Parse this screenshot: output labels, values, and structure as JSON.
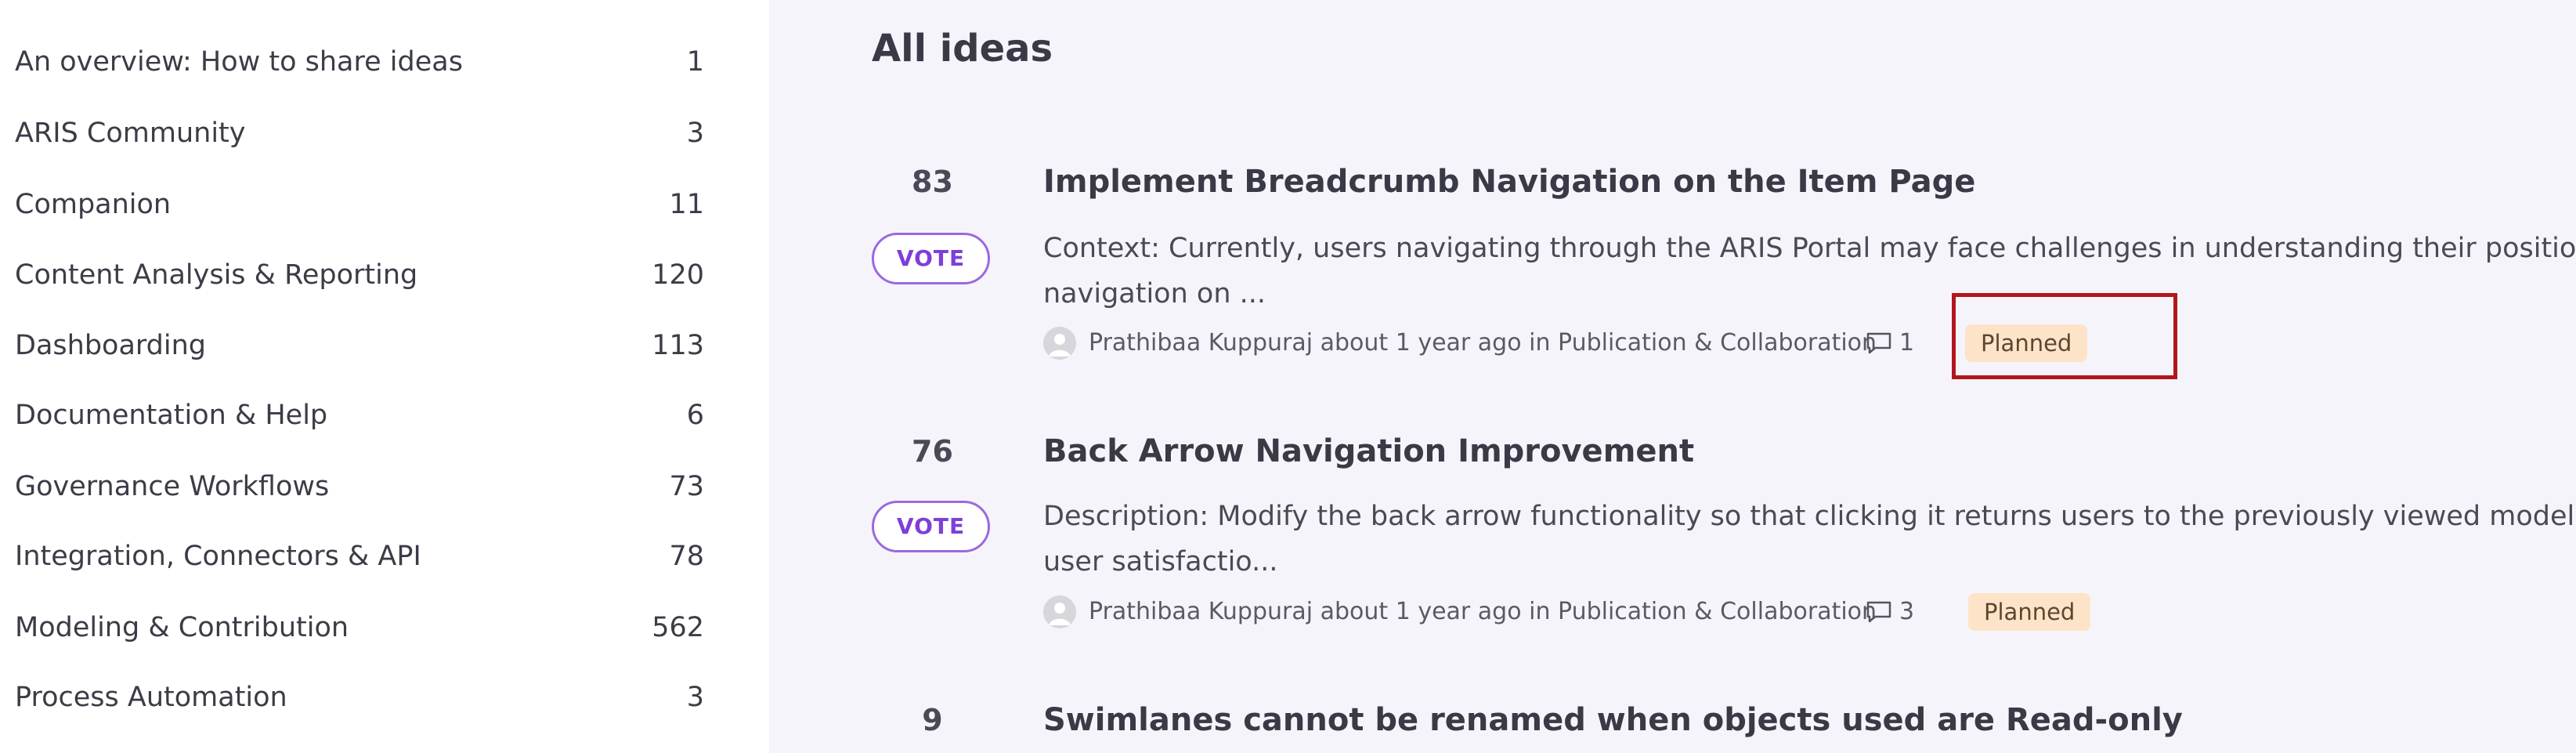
{
  "sidebar": {
    "items": [
      {
        "label": "An overview: How to share ideas",
        "count": "1"
      },
      {
        "label": "ARIS Community",
        "count": "3"
      },
      {
        "label": "Companion",
        "count": "11"
      },
      {
        "label": "Content Analysis & Reporting",
        "count": "120"
      },
      {
        "label": "Dashboarding",
        "count": "113"
      },
      {
        "label": "Documentation & Help",
        "count": "6"
      },
      {
        "label": "Governance Workflows",
        "count": "73"
      },
      {
        "label": "Integration, Connectors & API",
        "count": "78"
      },
      {
        "label": "Modeling & Contribution",
        "count": "562"
      },
      {
        "label": "Process Automation",
        "count": "3"
      }
    ]
  },
  "main": {
    "title": "All ideas",
    "vote_label": "VOTE",
    "ideas": [
      {
        "votes": "83",
        "title": "Implement Breadcrumb Navigation on the Item Page",
        "description_line1": "Context: Currently, users navigating through the ARIS Portal may face challenges in understanding their position",
        "description_line2": "navigation on ...",
        "meta": "Prathibaa Kuppuraj about 1 year ago in Publication & Collaboration",
        "comments": "1",
        "status": "Planned"
      },
      {
        "votes": "76",
        "title": "Back Arrow Navigation Improvement",
        "description_line1": "Description: Modify the back arrow functionality so that clicking it returns users to the previously viewed model",
        "description_line2": "user satisfactio...",
        "meta": "Prathibaa Kuppuraj about 1 year ago in Publication & Collaboration",
        "comments": "3",
        "status": "Planned"
      },
      {
        "votes": "9",
        "title": "Swimlanes cannot be renamed when objects used are Read-only"
      }
    ]
  },
  "colors": {
    "main_background": "#f6f4fb",
    "vote_accent": "#7d3fd8",
    "status_planned_bg": "#fde4c8",
    "highlight": "#b3161c"
  },
  "icons": {
    "avatar": "user-avatar-icon",
    "comment": "comment-icon"
  }
}
